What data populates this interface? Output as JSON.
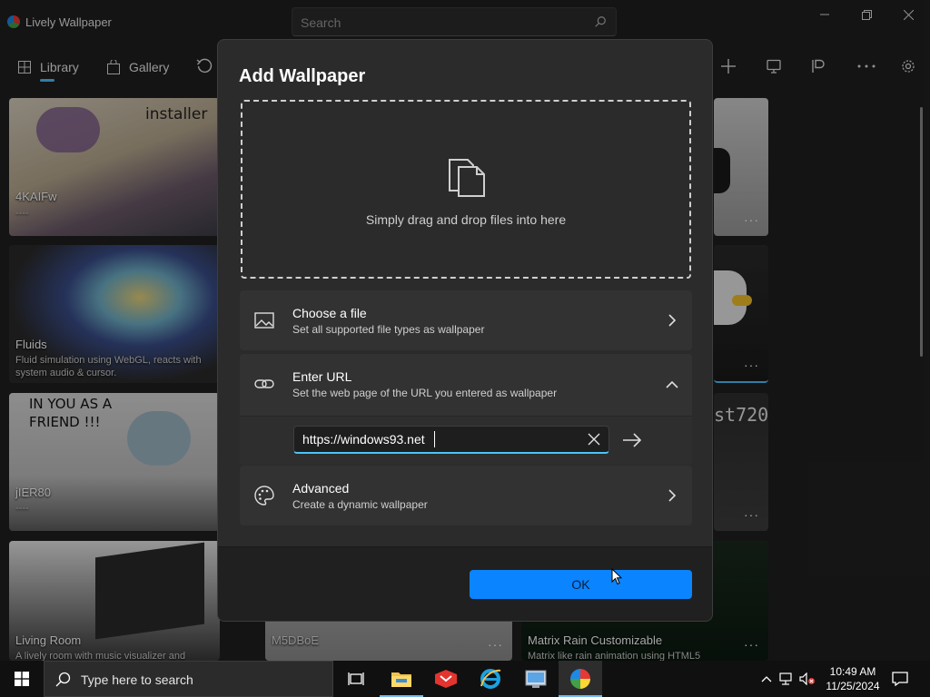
{
  "app": {
    "title": "Lively Wallpaper",
    "search_placeholder": "Search",
    "window_controls": [
      "minimize-icon",
      "maximize-icon",
      "close-icon"
    ]
  },
  "nav": {
    "library": "Library",
    "gallery": "Gallery"
  },
  "toolbar_icons": [
    "refresh-icon",
    "add-icon",
    "screen-icon",
    "control-panel-icon",
    "more-icon",
    "settings-icon"
  ],
  "cards": [
    {
      "name": "4KAIFw",
      "desc": "----",
      "thumb_text": "installer"
    },
    {
      "name": "Fluids",
      "desc": "Fluid simulation using WebGL, reacts with system audio & cursor."
    },
    {
      "name": "jIER80",
      "desc": "----",
      "thumb_text": "IN YOU AS A FRIEND !!!"
    },
    {
      "name": "Living Room",
      "desc": "A lively room with music visualizer and"
    },
    {
      "name": "M5DBoE",
      "desc": ""
    },
    {
      "name": "Matrix Rain Customizable",
      "desc": "Matrix like rain animation using HTML5"
    },
    {
      "name": "",
      "desc": "",
      "thumb_text": "st720"
    }
  ],
  "dialog": {
    "title": "Add Wallpaper",
    "drop_text": "Simply drag and drop files into here",
    "options": [
      {
        "title": "Choose a file",
        "subtitle": "Set all supported file types as wallpaper"
      },
      {
        "title": "Enter URL",
        "subtitle": "Set the web page of the URL you entered as wallpaper"
      },
      {
        "title": "Advanced",
        "subtitle": "Create a dynamic wallpaper"
      }
    ],
    "url_value": "https://windows93.net",
    "ok_label": "OK"
  },
  "taskbar": {
    "search_placeholder": "Type here to search",
    "time": "10:49 AM",
    "date": "11/25/2024"
  },
  "colors": {
    "accent": "#0a84ff",
    "focus": "#4cc2ff"
  }
}
